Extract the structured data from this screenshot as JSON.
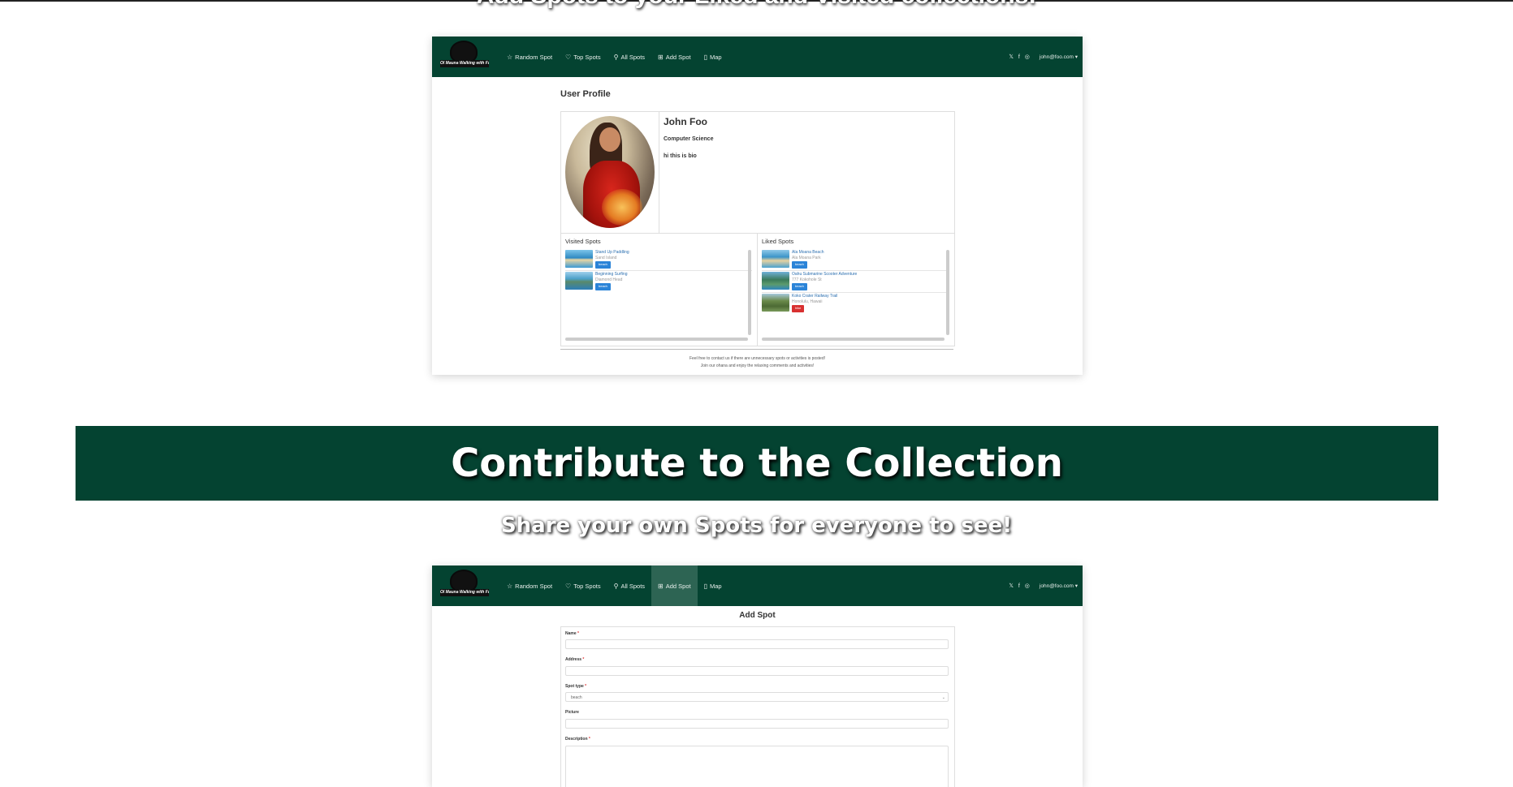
{
  "sections": {
    "liked_visited_heading": "Add Spots to your Liked and Visited collections!",
    "contribute_heading": "Contribute to the Collection",
    "contribute_subtitle": "Share your own Spots for everyone to see!"
  },
  "nav": {
    "logo_text": "Ol Mauna Walking with Foo",
    "items": [
      {
        "icon": "star-icon",
        "glyph": "☆",
        "label": "Random Spot"
      },
      {
        "icon": "heart-icon",
        "glyph": "♡",
        "label": "Top Spots"
      },
      {
        "icon": "map-pin-icon",
        "glyph": "⚲",
        "label": "All Spots"
      },
      {
        "icon": "plus-square-icon",
        "glyph": "⊞",
        "label": "Add Spot"
      },
      {
        "icon": "map-icon",
        "glyph": "▯",
        "label": "Map"
      }
    ],
    "social": "𝕏 f ◎",
    "user_email": "john@foo.com",
    "user_caret": "▾"
  },
  "profile_shot": {
    "page_title": "User Profile",
    "name": "John Foo",
    "major": "Computer Science",
    "bio": "hi this is bio",
    "visited_title": "Visited Spots",
    "liked_title": "Liked Spots",
    "visited": [
      {
        "name": "Stand Up Paddling",
        "address": "Sand Island",
        "badge": "beach",
        "badge_color": "#2b84d8"
      },
      {
        "name": "Beginning Surfing",
        "address": "Diamond Head",
        "badge": "beach",
        "badge_color": "#2b84d8"
      }
    ],
    "liked": [
      {
        "name": "Ala Moana Beach",
        "address": "Ala Moana Park",
        "badge": "beach",
        "badge_color": "#2b84d8"
      },
      {
        "name": "Oahu Submarine Scooter Adventure",
        "address": "777 Kokohole St",
        "badge": "beach",
        "badge_color": "#2b84d8"
      },
      {
        "name": "Koko Crater Railway Trail",
        "address": "Honolulu, Hawaii",
        "badge": "hike",
        "badge_color": "#d83030"
      }
    ],
    "footer_line1": "Feel free to contact us if there are unnecessary spots or activities is posted!",
    "footer_line2": "Join our ohana and enjoy the relaxing comments and activities!"
  },
  "add_shot": {
    "page_title": "Add Spot",
    "fields": {
      "name_label": "Name",
      "address_label": "Address",
      "spot_type_label": "Spot type",
      "spot_type_value": "beach",
      "picture_label": "Picture",
      "description_label": "Description",
      "required_mark": "*"
    }
  },
  "colors": {
    "brand_green": "#044331",
    "nav_active": "#2d6453",
    "link_blue": "#2b6fb0",
    "badge_blue": "#2b84d8",
    "badge_red": "#d83030"
  }
}
